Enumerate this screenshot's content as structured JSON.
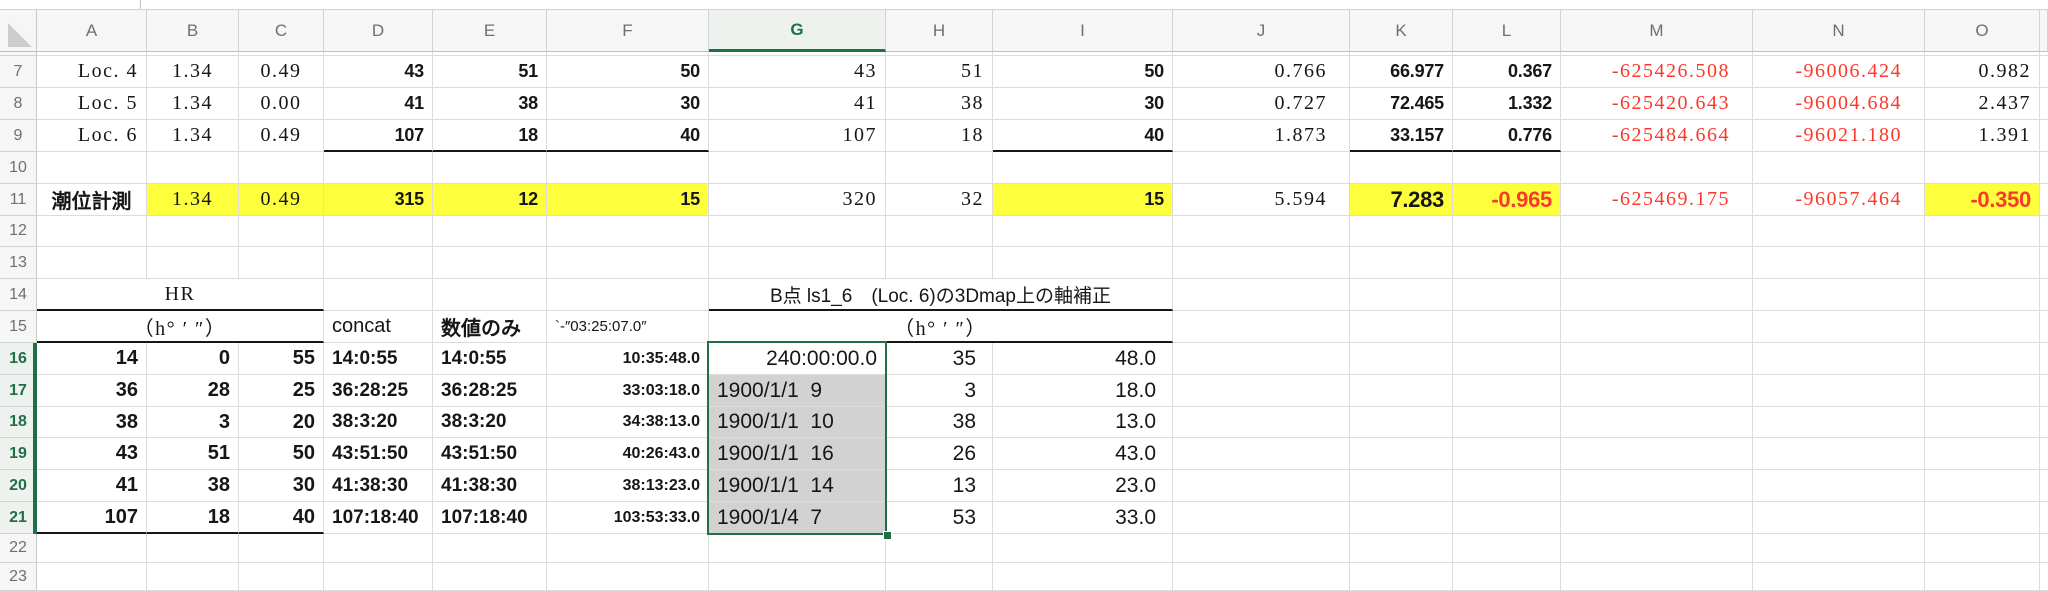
{
  "sheet": {
    "colors": {
      "accent_green": "#1F7145",
      "highlight_yellow": "#FDFF3C",
      "warning_red": "#FA392C",
      "selection_gray": "#D2D2D2"
    },
    "column_headers": [
      "A",
      "B",
      "C",
      "D",
      "E",
      "F",
      "G",
      "H",
      "I",
      "J",
      "K",
      "L",
      "M",
      "N",
      "O",
      ""
    ],
    "row_headers": [
      "",
      "7",
      "8",
      "9",
      "10",
      "11",
      "12",
      "13",
      "14",
      "15",
      "16",
      "17",
      "18",
      "19",
      "20",
      "21",
      "22",
      "23"
    ],
    "selected_column": "G",
    "selected_rows": [
      "16",
      "17",
      "18",
      "19",
      "20",
      "21"
    ],
    "selection": {
      "range": "G16:G21",
      "active_cell": "G16"
    },
    "cells": [
      {
        "ref": "A7",
        "text": "Loc. 4",
        "cls": "sf"
      },
      {
        "ref": "B7",
        "text": "1.34",
        "cls": "sf ac"
      },
      {
        "ref": "C7",
        "text": "0.49",
        "cls": "sf ac"
      },
      {
        "ref": "D7",
        "text": "43",
        "cls": "bs"
      },
      {
        "ref": "E7",
        "text": "51",
        "cls": "bs"
      },
      {
        "ref": "F7",
        "text": "50",
        "cls": "bs"
      },
      {
        "ref": "G7",
        "text": "43",
        "cls": "sf"
      },
      {
        "ref": "H7",
        "text": "51",
        "cls": "sf"
      },
      {
        "ref": "I7",
        "text": "50",
        "cls": "bs"
      },
      {
        "ref": "J7",
        "text": "0.766",
        "cls": "sf padj"
      },
      {
        "ref": "K7",
        "text": "66.977",
        "cls": "bs"
      },
      {
        "ref": "L7",
        "text": "0.367",
        "cls": "bs"
      },
      {
        "ref": "M7",
        "text": "-625426.508",
        "cls": "sf red padj"
      },
      {
        "ref": "N7",
        "text": "-96006.424",
        "cls": "sf red padj"
      },
      {
        "ref": "O7",
        "text": "0.982",
        "cls": "sf"
      },
      {
        "ref": "A8",
        "text": "Loc. 5",
        "cls": "sf"
      },
      {
        "ref": "B8",
        "text": "1.34",
        "cls": "sf ac"
      },
      {
        "ref": "C8",
        "text": "0.00",
        "cls": "sf ac"
      },
      {
        "ref": "D8",
        "text": "41",
        "cls": "bs"
      },
      {
        "ref": "E8",
        "text": "38",
        "cls": "bs"
      },
      {
        "ref": "F8",
        "text": "30",
        "cls": "bs"
      },
      {
        "ref": "G8",
        "text": "41",
        "cls": "sf"
      },
      {
        "ref": "H8",
        "text": "38",
        "cls": "sf"
      },
      {
        "ref": "I8",
        "text": "30",
        "cls": "bs"
      },
      {
        "ref": "J8",
        "text": "0.727",
        "cls": "sf padj"
      },
      {
        "ref": "K8",
        "text": "72.465",
        "cls": "bs"
      },
      {
        "ref": "L8",
        "text": "1.332",
        "cls": "bs"
      },
      {
        "ref": "M8",
        "text": "-625420.643",
        "cls": "sf red padj"
      },
      {
        "ref": "N8",
        "text": "-96004.684",
        "cls": "sf red padj"
      },
      {
        "ref": "O8",
        "text": "2.437",
        "cls": "sf"
      },
      {
        "ref": "A9",
        "text": "Loc. 6",
        "cls": "sf"
      },
      {
        "ref": "B9",
        "text": "1.34",
        "cls": "sf ac"
      },
      {
        "ref": "C9",
        "text": "0.49",
        "cls": "sf ac"
      },
      {
        "ref": "D9",
        "text": "107",
        "cls": "bs bb"
      },
      {
        "ref": "E9",
        "text": "18",
        "cls": "bs bb"
      },
      {
        "ref": "F9",
        "text": "40",
        "cls": "bs bb"
      },
      {
        "ref": "G9",
        "text": "107",
        "cls": "sf"
      },
      {
        "ref": "H9",
        "text": "18",
        "cls": "sf"
      },
      {
        "ref": "I9",
        "text": "40",
        "cls": "bs bb"
      },
      {
        "ref": "J9",
        "text": "1.873",
        "cls": "sf padj"
      },
      {
        "ref": "K9",
        "text": "33.157",
        "cls": "bs bb"
      },
      {
        "ref": "L9",
        "text": "0.776",
        "cls": "bs bb"
      },
      {
        "ref": "M9",
        "text": "-625484.664",
        "cls": "sf red padj"
      },
      {
        "ref": "N9",
        "text": "-96021.180",
        "cls": "sf red padj"
      },
      {
        "ref": "O9",
        "text": "1.391",
        "cls": "sf"
      },
      {
        "ref": "A11",
        "text": "潮位計測",
        "cls": "b cjk ac"
      },
      {
        "ref": "B11",
        "text": "1.34",
        "cls": "sf ac yel"
      },
      {
        "ref": "C11",
        "text": "0.49",
        "cls": "sf ac yel"
      },
      {
        "ref": "D11",
        "text": "315",
        "cls": "bs yel"
      },
      {
        "ref": "E11",
        "text": "12",
        "cls": "bs yel"
      },
      {
        "ref": "F11",
        "text": "15",
        "cls": "bs yel"
      },
      {
        "ref": "G11",
        "text": "320",
        "cls": "sf"
      },
      {
        "ref": "H11",
        "text": "32",
        "cls": "sf"
      },
      {
        "ref": "I11",
        "text": "15",
        "cls": "bs yel"
      },
      {
        "ref": "J11",
        "text": "5.594",
        "cls": "sf padj"
      },
      {
        "ref": "K11",
        "text": "7.283",
        "cls": "xl yel"
      },
      {
        "ref": "L11",
        "text": "-0.965",
        "cls": "xl red yel"
      },
      {
        "ref": "M11",
        "text": "-625469.175",
        "cls": "sf red padj"
      },
      {
        "ref": "N11",
        "text": "-96057.464",
        "cls": "sf red padj"
      },
      {
        "ref": "O11",
        "text": "-0.350",
        "cls": "xl red yel"
      },
      {
        "ref": "A14",
        "span": 3,
        "text": "HR",
        "cls": "sf ac bb"
      },
      {
        "ref": "G14",
        "span": 3,
        "text": "B点 ls1_6　(Loc. 6)の3Dmap上の軸補正",
        "cls": "ac bb t19 w5 cjk"
      },
      {
        "ref": "A15",
        "span": 3,
        "text": "（h° ′ ″）",
        "cls": "sf ac bb"
      },
      {
        "ref": "D15",
        "text": "concat",
        "cls": "al"
      },
      {
        "ref": "E15",
        "text": "数値のみ",
        "cls": "al b cjk"
      },
      {
        "ref": "F15",
        "text": "`-″03:25:07.0″",
        "cls": "al xs"
      },
      {
        "ref": "G15",
        "span": 3,
        "text": "（h° ′ ″）",
        "cls": "sf ac bb"
      },
      {
        "ref": "A16",
        "text": "14",
        "cls": "w6"
      },
      {
        "ref": "B16",
        "text": "0",
        "cls": "w6"
      },
      {
        "ref": "C16",
        "text": "55",
        "cls": "w6"
      },
      {
        "ref": "D16",
        "text": "14:0:55",
        "cls": "al w6 t19"
      },
      {
        "ref": "E16",
        "text": "14:0:55",
        "cls": "al w6 t19"
      },
      {
        "ref": "F16",
        "text": "10:35:48.0",
        "cls": "sm w6"
      },
      {
        "ref": "G16",
        "text": "240:00:00.0",
        "cls": "lg"
      },
      {
        "ref": "H16",
        "text": "35",
        "cls": "lg padh"
      },
      {
        "ref": "I16",
        "text": "48.0",
        "cls": "lg padh"
      },
      {
        "ref": "A17",
        "text": "36",
        "cls": "w6"
      },
      {
        "ref": "B17",
        "text": "28",
        "cls": "w6"
      },
      {
        "ref": "C17",
        "text": "25",
        "cls": "w6"
      },
      {
        "ref": "D17",
        "text": "36:28:25",
        "cls": "al w6 t19"
      },
      {
        "ref": "E17",
        "text": "36:28:25",
        "cls": "al w6 t19"
      },
      {
        "ref": "F17",
        "text": "33:03:18.0",
        "cls": "sm w6"
      },
      {
        "ref": "G17",
        "text": "1900/1/1  9",
        "cls": "al lg sel"
      },
      {
        "ref": "H17",
        "text": "3",
        "cls": "lg padh"
      },
      {
        "ref": "I17",
        "text": "18.0",
        "cls": "lg padh"
      },
      {
        "ref": "A18",
        "text": "38",
        "cls": "w6"
      },
      {
        "ref": "B18",
        "text": "3",
        "cls": "w6"
      },
      {
        "ref": "C18",
        "text": "20",
        "cls": "w6"
      },
      {
        "ref": "D18",
        "text": "38:3:20",
        "cls": "al w6 t19"
      },
      {
        "ref": "E18",
        "text": "38:3:20",
        "cls": "al w6 t19"
      },
      {
        "ref": "F18",
        "text": "34:38:13.0",
        "cls": "sm w6"
      },
      {
        "ref": "G18",
        "text": "1900/1/1  10",
        "cls": "al lg sel"
      },
      {
        "ref": "H18",
        "text": "38",
        "cls": "lg padh"
      },
      {
        "ref": "I18",
        "text": "13.0",
        "cls": "lg padh"
      },
      {
        "ref": "A19",
        "text": "43",
        "cls": "w6"
      },
      {
        "ref": "B19",
        "text": "51",
        "cls": "w6"
      },
      {
        "ref": "C19",
        "text": "50",
        "cls": "w6"
      },
      {
        "ref": "D19",
        "text": "43:51:50",
        "cls": "al w6 t19"
      },
      {
        "ref": "E19",
        "text": "43:51:50",
        "cls": "al w6 t19"
      },
      {
        "ref": "F19",
        "text": "40:26:43.0",
        "cls": "sm w6"
      },
      {
        "ref": "G19",
        "text": "1900/1/1  16",
        "cls": "al lg sel"
      },
      {
        "ref": "H19",
        "text": "26",
        "cls": "lg padh"
      },
      {
        "ref": "I19",
        "text": "43.0",
        "cls": "lg padh"
      },
      {
        "ref": "A20",
        "text": "41",
        "cls": "w6"
      },
      {
        "ref": "B20",
        "text": "38",
        "cls": "w6"
      },
      {
        "ref": "C20",
        "text": "30",
        "cls": "w6"
      },
      {
        "ref": "D20",
        "text": "41:38:30",
        "cls": "al w6 t19"
      },
      {
        "ref": "E20",
        "text": "41:38:30",
        "cls": "al w6 t19"
      },
      {
        "ref": "F20",
        "text": "38:13:23.0",
        "cls": "sm w6"
      },
      {
        "ref": "G20",
        "text": "1900/1/1  14",
        "cls": "al lg sel"
      },
      {
        "ref": "H20",
        "text": "13",
        "cls": "lg padh"
      },
      {
        "ref": "I20",
        "text": "23.0",
        "cls": "lg padh"
      },
      {
        "ref": "A21",
        "text": "107",
        "cls": "w6 bb"
      },
      {
        "ref": "B21",
        "text": "18",
        "cls": "w6 bb"
      },
      {
        "ref": "C21",
        "text": "40",
        "cls": "w6 bb"
      },
      {
        "ref": "D21",
        "text": "107:18:40",
        "cls": "al w6 t19"
      },
      {
        "ref": "E21",
        "text": "107:18:40",
        "cls": "al w6 t19"
      },
      {
        "ref": "F21",
        "text": "103:53:33.0",
        "cls": "sm w6"
      },
      {
        "ref": "G21",
        "text": "1900/1/4  7",
        "cls": "al lg sel"
      },
      {
        "ref": "H21",
        "text": "53",
        "cls": "lg padh"
      },
      {
        "ref": "I21",
        "text": "33.0",
        "cls": "lg padh"
      }
    ]
  }
}
